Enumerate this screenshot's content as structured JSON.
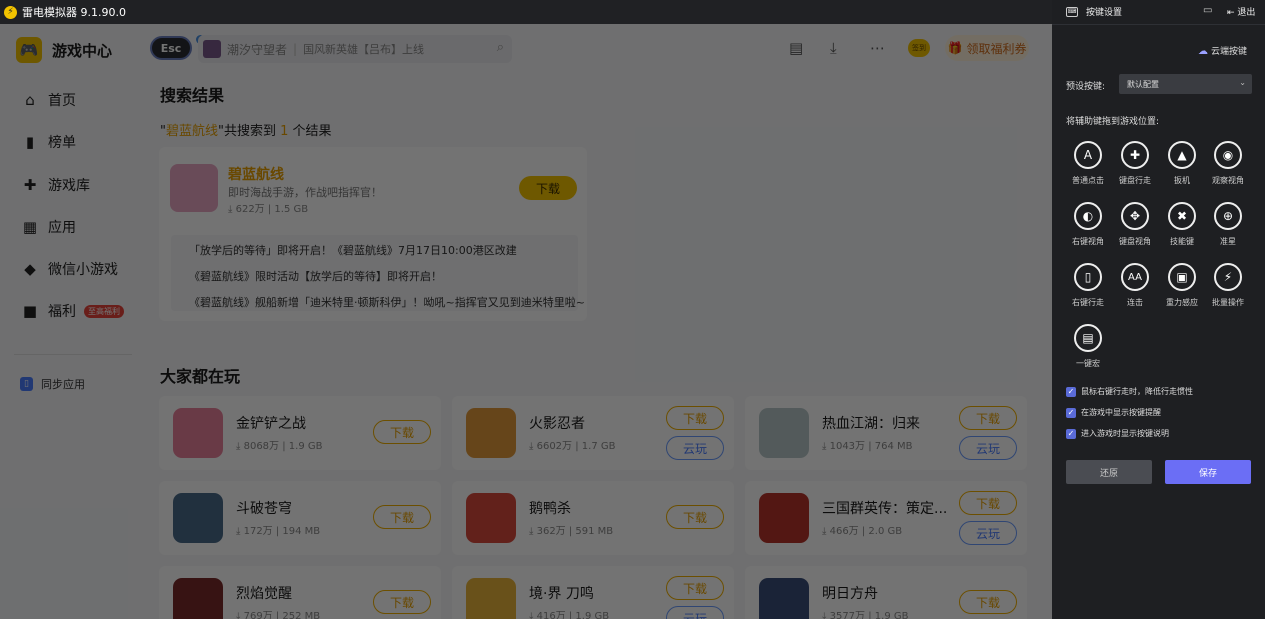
{
  "titlebar": {
    "title": "雷电模拟器 9.1.90.0"
  },
  "sidebar": {
    "brand": "游戏中心",
    "items": [
      {
        "label": "首页",
        "icon": "home-icon",
        "glyph": "⌂"
      },
      {
        "label": "榜单",
        "icon": "ranking-icon",
        "glyph": "▮"
      },
      {
        "label": "游戏库",
        "icon": "gamepad-icon",
        "glyph": "✚"
      },
      {
        "label": "应用",
        "icon": "apps-icon",
        "glyph": "▦"
      },
      {
        "label": "微信小游戏",
        "icon": "wechat-game-icon",
        "glyph": "◆"
      },
      {
        "label": "福利",
        "icon": "gift-icon",
        "glyph": "■",
        "badge": "至高福利"
      }
    ],
    "sync": "同步应用"
  },
  "header": {
    "esc": "Esc",
    "search_text": "潮汐守望者",
    "search_hint": "国风新英雄【吕布】上线",
    "welfare": "领取福利券",
    "signin": "签到"
  },
  "search_results": {
    "title": "搜索结果",
    "query": "碧蓝航线",
    "count": "1",
    "prefix": "\"",
    "mid": "\"共搜索到 ",
    "suffix": " 个结果",
    "game": {
      "name": "碧蓝航线",
      "desc": "即时海战手游，作战吧指挥官！",
      "meta": "⤓ 622万 | 1.5 GB",
      "button": "下载"
    },
    "news": [
      "「放学后的等待」即将开启！《碧蓝航线》7月17日10:00港区改建",
      "《碧蓝航线》限时活动【放学后的等待】即将开启！",
      "《碧蓝航线》舰船新增「迪米特里·顿斯科伊」！呦吼~指挥官又见到迪米特里啦~"
    ]
  },
  "popular": {
    "title": "大家都在玩",
    "download": "下载",
    "cloud": "云玩",
    "games": [
      {
        "name": "金铲铲之战",
        "meta": "⤓ 8068万 | 1.9 GB",
        "cloud": false,
        "color": "#e9809b"
      },
      {
        "name": "火影忍者",
        "meta": "⤓ 6602万 | 1.7 GB",
        "cloud": true,
        "color": "#e39a3b"
      },
      {
        "name": "热血江湖：归来",
        "meta": "⤓ 1043万 | 764 MB",
        "cloud": true,
        "color": "#b9c8c9"
      },
      {
        "name": "斗破苍穹",
        "meta": "⤓ 172万 | 194 MB",
        "cloud": false,
        "color": "#4a6b8a"
      },
      {
        "name": "鹅鸭杀",
        "meta": "⤓ 362万 | 591 MB",
        "cloud": false,
        "color": "#d94a3c"
      },
      {
        "name": "三国群英传：策定...",
        "meta": "⤓ 466万 | 2.0 GB",
        "cloud": true,
        "color": "#b8332c"
      },
      {
        "name": "烈焰觉醒",
        "meta": "⤓ 769万 | 252 MB",
        "cloud": false,
        "color": "#7a2c2c"
      },
      {
        "name": "境·界 刀鸣",
        "meta": "⤓ 416万 | 1.9 GB",
        "cloud": true,
        "color": "#e8b43a"
      },
      {
        "name": "明日方舟",
        "meta": "⤓ 3577万 | 1.9 GB",
        "cloud": false,
        "color": "#3b4f7a"
      }
    ]
  },
  "panel": {
    "title": "按键设置",
    "exit": "退出",
    "cloud_keys": "云端按键",
    "preset_label": "预设按键:",
    "preset_value": "默认配置",
    "drag_label": "将辅助键拖到游戏位置:",
    "keys": [
      {
        "label": "普通点击",
        "glyph": "A",
        "icon": "tap-icon"
      },
      {
        "label": "键盘行走",
        "glyph": "✚",
        "icon": "dpad-icon"
      },
      {
        "label": "扳机",
        "glyph": "▲",
        "icon": "trigger-icon"
      },
      {
        "label": "观察视角",
        "glyph": "◉",
        "icon": "eye-icon"
      },
      {
        "label": "右键视角",
        "glyph": "◐",
        "icon": "right-view-icon"
      },
      {
        "label": "键盘视角",
        "glyph": "✥",
        "icon": "keyboard-view-icon"
      },
      {
        "label": "技能键",
        "glyph": "✖",
        "icon": "skill-icon"
      },
      {
        "label": "准星",
        "glyph": "⊕",
        "icon": "crosshair-icon"
      },
      {
        "label": "右键行走",
        "glyph": "▯",
        "icon": "mouse-icon"
      },
      {
        "label": "连击",
        "glyph": "AA",
        "icon": "combo-icon"
      },
      {
        "label": "重力感应",
        "glyph": "▣",
        "icon": "gravity-icon"
      },
      {
        "label": "批量操作",
        "glyph": "⚡",
        "icon": "batch-icon"
      },
      {
        "label": "一键宏",
        "glyph": "▤",
        "icon": "macro-icon"
      }
    ],
    "checks": [
      "鼠标右键行走时，降低行走惯性",
      "在游戏中显示按键提醒",
      "进入游戏时显示按键说明"
    ],
    "reset": "还原",
    "save": "保存"
  }
}
